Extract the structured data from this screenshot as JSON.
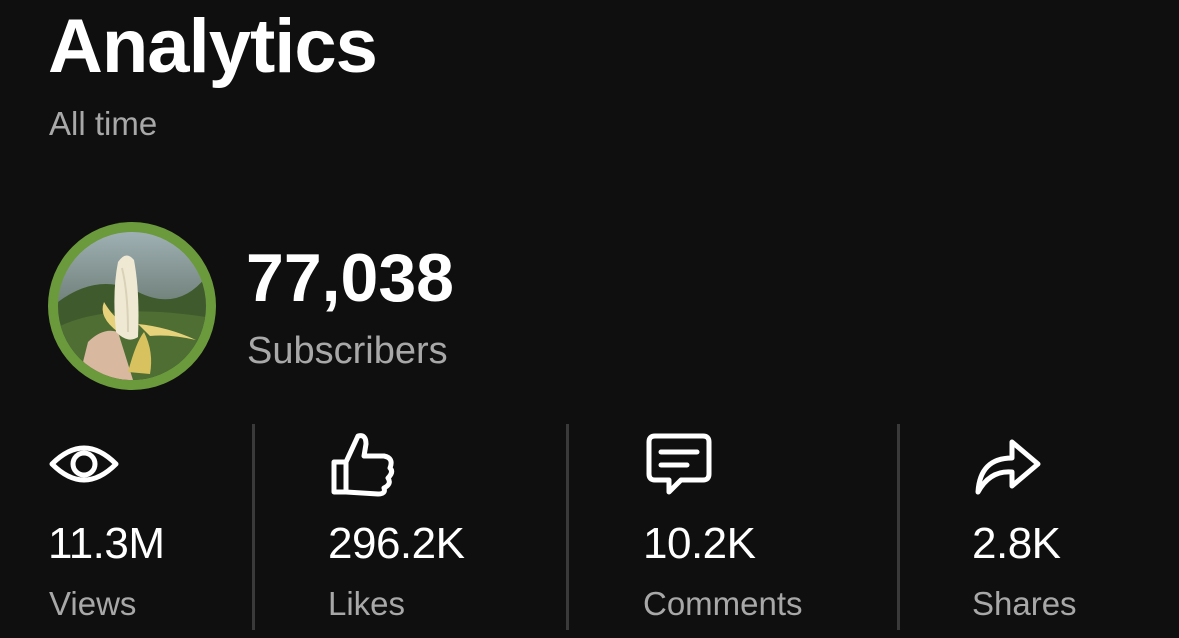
{
  "header": {
    "title": "Analytics",
    "subtitle": "All time"
  },
  "channel": {
    "avatar_icon": "banana-photo",
    "avatar_ring_color": "#6b9a3c",
    "subscriber_count": "77,038",
    "subscriber_label": "Subscribers"
  },
  "stats": [
    {
      "icon": "eye-icon",
      "value": "11.3M",
      "label": "Views"
    },
    {
      "icon": "thumbs-up-icon",
      "value": "296.2K",
      "label": "Likes"
    },
    {
      "icon": "comment-icon",
      "value": "10.2K",
      "label": "Comments"
    },
    {
      "icon": "share-icon",
      "value": "2.8K",
      "label": "Shares"
    }
  ],
  "colors": {
    "background": "#0f0f0f",
    "text_primary": "#ffffff",
    "text_secondary": "#a8a8a8",
    "divider": "#3a3a3a"
  }
}
